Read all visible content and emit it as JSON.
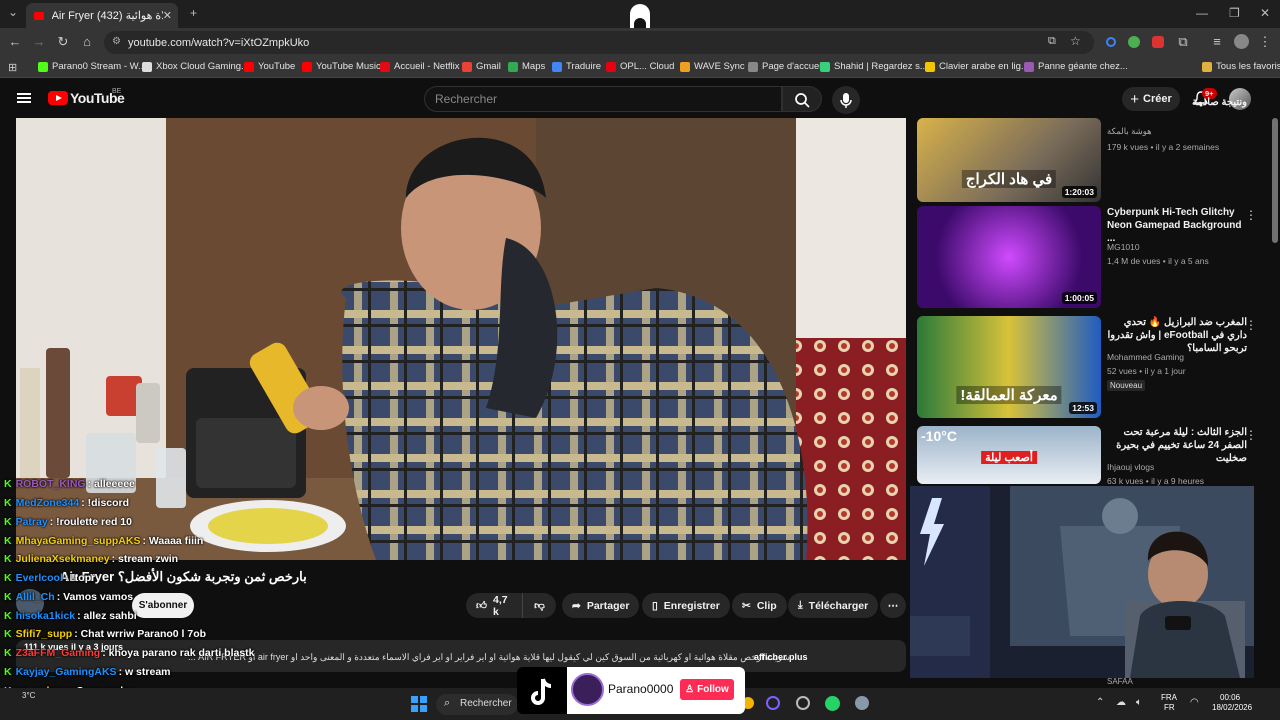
{
  "browser": {
    "tab_title": "Air Fryer مقلاة هوائية (432)",
    "tab_close": "✕",
    "new_tab": "+",
    "url": "youtube.com/watch?v=iXtOZmpkUko",
    "bookmarks": [
      {
        "label": "Parano0 Stream - W...",
        "color": "#53fc18"
      },
      {
        "label": "Xbox Cloud Gaming...",
        "color": "#dddddd"
      },
      {
        "label": "YouTube",
        "color": "#ff0000"
      },
      {
        "label": "YouTube Music",
        "color": "#ff0000"
      },
      {
        "label": "Accueil - Netflix",
        "color": "#e50914"
      },
      {
        "label": "Gmail",
        "color": "#ea4335"
      },
      {
        "label": "Maps",
        "color": "#34a853"
      },
      {
        "label": "Traduire",
        "color": "#4285f4"
      },
      {
        "label": "OPL... Cloud",
        "color": "#e60012"
      },
      {
        "label": "WAVE Sync",
        "color": "#f0a020"
      },
      {
        "label": "Page d'accueil",
        "color": "#888888"
      },
      {
        "label": "Shahid | Regardez s...",
        "color": "#36d17c"
      },
      {
        "label": "Clavier arabe en lig...",
        "color": "#f5c400"
      },
      {
        "label": "Panne géante chez...",
        "color": "#9b59b6"
      }
    ],
    "all_bookmarks": "Tous les favoris"
  },
  "youtube": {
    "logo": "YouTube",
    "region": "BE",
    "search_placeholder": "Rechercher",
    "create_label": "Créer",
    "notif_badge": "9+"
  },
  "video": {
    "title": "Air Fryer بارخص ثمن وتجربة شكون الأفضل؟",
    "subscribe": "S'abonner",
    "likes": "4,7 k",
    "share": "Partager",
    "save": "Enregistrer",
    "clip": "Clip",
    "download": "Télécharger",
    "description_meta": "111 k vues  il y a 3 jours",
    "description": "شريت ارخص مقلاة هوائية او كهربائية من السوق كين لي كيقول ليها قلاية هوائية او اير فراير او اير فراي الاسماء متعددة و المعنى واحد او air fryer او AIR FRYER ...",
    "afficher_plus": "afficher plus"
  },
  "chat": [
    {
      "user": "ROBOT_KING",
      "color": "#9b59b6",
      "msg": ": alleeeee"
    },
    {
      "user": "MedZone344",
      "color": "#1e90ff",
      "msg": ": !discord"
    },
    {
      "user": "Patray",
      "color": "#1e90ff",
      "msg": ": !roulette red 10"
    },
    {
      "user": "MhayaGaming_suppAKS",
      "color": "#f5d000",
      "msg": ": Waaaa fiiin"
    },
    {
      "user": "JulienaXsekmaney",
      "color": "#f5d000",
      "msg": ": stream zwin"
    },
    {
      "user": "Everlcool",
      "color": "#1e90ff",
      "msg": ": !topr"
    },
    {
      "user": "Allil_Ch",
      "color": "#1e90ff",
      "msg": ": Vamos vamos"
    },
    {
      "user": "hisoka1kick",
      "color": "#1e90ff",
      "msg": ": allez sahbi"
    },
    {
      "user": "Sfifi7_supp",
      "color": "#f5d000",
      "msg": ": Chat wrriw Parano0 l 7ob"
    },
    {
      "user": "Z3aFFM_Gaming",
      "color": "#ff3b3b",
      "msg": ": khoya parano rak darti blastk"
    },
    {
      "user": "Kayjay_GamingAKS",
      "color": "#1e90ff",
      "msg": ": w stream"
    },
    {
      "user": "qc_mdsup",
      "color": "#f5d000",
      "msg": ": Save replay"
    },
    {
      "user": "SouhailGaming_supp",
      "color": "#f5d000",
      "msg": ": Hadchi top"
    }
  ],
  "related": [
    {
      "title": "ونتيجة صادمة",
      "channel": "هوشة بالمكة",
      "views": "179 k vues • il y a 2 semaines",
      "duration": "1:20:03",
      "badge": "",
      "thumb_text": "في هاد الكراج"
    },
    {
      "title": "Cyberpunk Hi-Tech Glitchy Neon Gamepad Background ...",
      "channel": "MG1010",
      "views": "1,4 M de vues • il y a 5 ans",
      "duration": "1:00:05",
      "badge": "",
      "thumb_text": ""
    },
    {
      "title": "المغرب ضد البرازيل 🔥 تحدي داري في eFootball | واش تقدروا تربحو السامبا؟",
      "channel": "Mohammed Gaming",
      "views": "52 vues • il y a 1 jour",
      "duration": "12:53",
      "badge": "Nouveau",
      "thumb_text": "معركة العمالقة!"
    },
    {
      "title": "الجزء الثالث : ليلة مرعبة تحت الصفر 24 ساعة تخييم في بحيرة صخليت",
      "channel": "Ihjaouj vlogs",
      "views": "63 k vues • il y a 9 heures",
      "duration": "",
      "badge": "",
      "thumb_text": "أصعب ليلة"
    }
  ],
  "related_thumb_extra": "-10°C",
  "webcam_channel": "SAFAA",
  "tiktok": {
    "name": "Parano0000",
    "follow": "Follow"
  },
  "taskbar": {
    "search": "Rechercher",
    "lang": "FRA",
    "lang2": "FR",
    "time": "00:06",
    "date": "18/02/2026",
    "weather": "3°C"
  },
  "colors": {
    "yt_red": "#ff0000",
    "kick_green": "#53fc18",
    "tiktok_pink": "#fe2c55"
  }
}
